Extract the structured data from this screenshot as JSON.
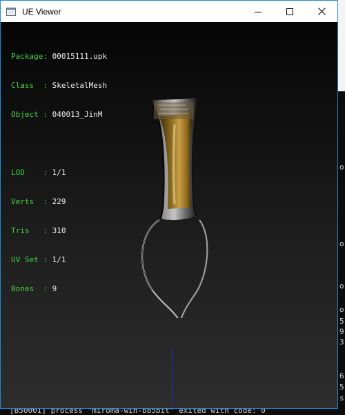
{
  "window": {
    "title": "UE Viewer"
  },
  "titlebar": {
    "controls": [
      "minimize-icon",
      "maximize-icon",
      "close-icon"
    ]
  },
  "info": {
    "package": {
      "label": "Package:",
      "value": "00015111.upk"
    },
    "class": {
      "label": "Class  :",
      "value": "SkeletalMesh"
    },
    "object": {
      "label": "Object :",
      "value": "040013_JinM"
    },
    "lod": {
      "label": "LOD    :",
      "value": "1/1"
    },
    "verts": {
      "label": "Verts  :",
      "value": "229"
    },
    "tris": {
      "label": "Tris   :",
      "value": "310"
    },
    "uvset": {
      "label": "UV Set :",
      "value": "1/1"
    },
    "bones": {
      "label": "Bones  :",
      "value": "9"
    }
  },
  "background_console": {
    "bottom_line": "[B50001] process \"miroma-win-b85bit\" exited with code: 0",
    "side_chars": [
      "o",
      "o",
      "o",
      "o",
      "5",
      "9",
      "3",
      "6",
      "5",
      "s"
    ]
  },
  "colors": {
    "label_green": "#41d541",
    "value_white": "#f0f0f0",
    "axis_blue": "#1a2bd6",
    "window_border": "#1f8ad3"
  }
}
